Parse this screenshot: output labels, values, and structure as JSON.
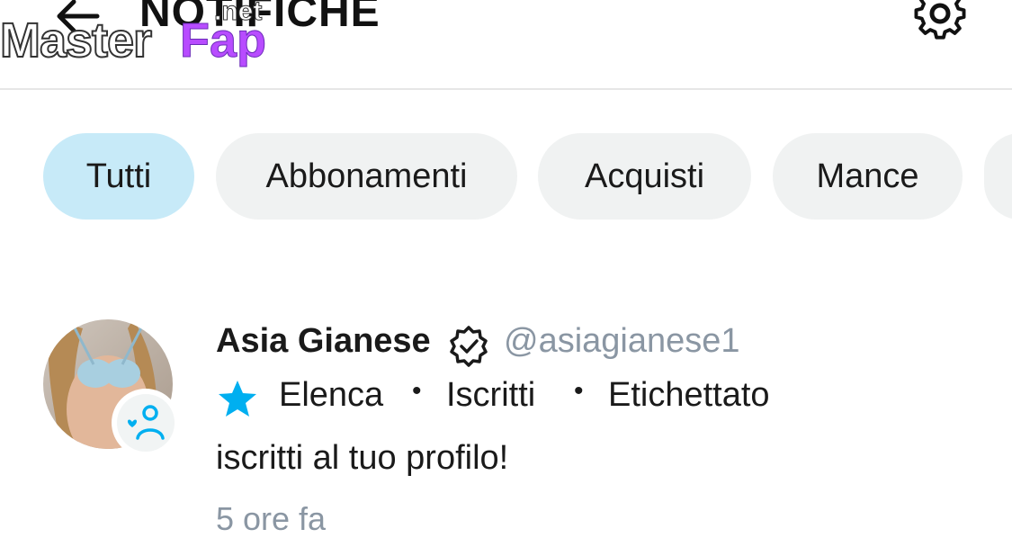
{
  "header": {
    "title": "NOTIFICHE",
    "back_icon": "arrow-left-icon",
    "settings_icon": "gear-icon"
  },
  "watermark": {
    "part1": "Master",
    "part2": "Fap",
    "part3": ".net"
  },
  "tabs": [
    {
      "label": "Tutti",
      "active": true
    },
    {
      "label": "Abbonamenti",
      "active": false
    },
    {
      "label": "Acquisti",
      "active": false
    },
    {
      "label": "Mance",
      "active": false
    }
  ],
  "notification": {
    "name": "Asia Gianese",
    "handle": "@asiagianese1",
    "verified_icon": "verified-badge-icon",
    "star_icon": "star-icon",
    "meta": [
      "Elenca",
      "Iscritti",
      "Etichettato"
    ],
    "message": "iscritti al tuo profilo!",
    "time": "5 ore fa",
    "avatar_badge_icon": "user-heart-icon"
  },
  "colors": {
    "accent": "#00aff0",
    "active_tab": "#c7eaf8",
    "tab_bg": "#f0f2f2",
    "muted_text": "#8a96a3"
  }
}
